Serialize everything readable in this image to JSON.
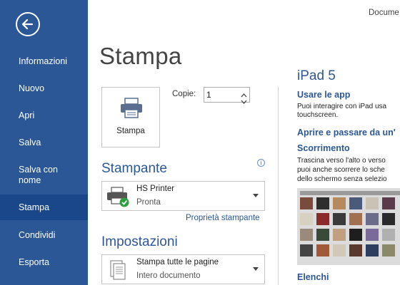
{
  "window": {
    "doc_title": "Docume"
  },
  "sidebar": {
    "items": [
      {
        "label": "Informazioni"
      },
      {
        "label": "Nuovo"
      },
      {
        "label": "Apri"
      },
      {
        "label": "Salva"
      },
      {
        "label": "Salva con nome"
      },
      {
        "label": "Stampa",
        "active": true
      },
      {
        "label": "Condividi"
      },
      {
        "label": "Esporta"
      }
    ]
  },
  "print": {
    "title": "Stampa",
    "button_label": "Stampa",
    "copies_label": "Copie:",
    "copies_value": "1"
  },
  "printer": {
    "section_title": "Stampante",
    "name": "HS Printer",
    "status": "Pronta",
    "properties_link": "Proprietà stampante",
    "info_glyph": "i"
  },
  "settings": {
    "section_title": "Impostazioni",
    "range_main": "Stampa tutte le pagine",
    "range_sub": "Intero documento"
  },
  "preview": {
    "heading": "iPad 5",
    "section1_title": "Usare le app",
    "section1_line1": "Puoi interagire con iPad usa",
    "section1_line2": "touchscreen.",
    "section2_title": "Aprire e passare da un'",
    "section3_title": "Scorrimento",
    "section3_line1": "Trascina verso l'alto o verso",
    "section3_line2": "puoi anche scorrere lo sche",
    "section3_line3": "dello schermo senza selezio",
    "section4_title": "Elenchi"
  },
  "colors": {
    "accent": "#2b5797",
    "sidebar_active": "#19478a"
  }
}
